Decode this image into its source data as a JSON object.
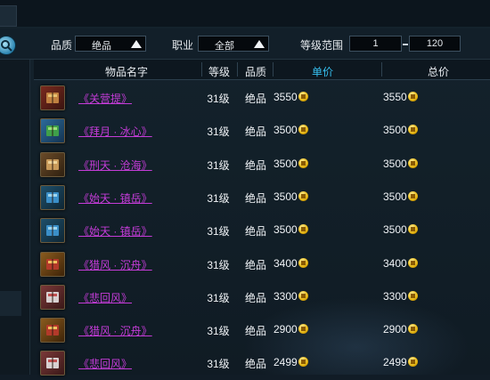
{
  "filters": {
    "quality_label": "品质",
    "quality_value": "绝品",
    "class_label": "职业",
    "class_value": "全部",
    "level_range_label": "等级范围",
    "level_min": "1",
    "level_max": "120"
  },
  "table": {
    "columns": [
      "物品名字",
      "等级",
      "品质",
      "单价",
      "总价"
    ],
    "rows": [
      {
        "name": "《关营提》",
        "level": "31级",
        "quality": "绝品",
        "price": "3550",
        "total": "3550",
        "icon": "gift-box-icon"
      },
      {
        "name": "《拜月 · 冰心》",
        "level": "31级",
        "quality": "绝品",
        "price": "3500",
        "total": "3500",
        "icon": "green-book-icon"
      },
      {
        "name": "《刑天 · 沧海》",
        "level": "31级",
        "quality": "绝品",
        "price": "3500",
        "total": "3500",
        "icon": "scroll-icon"
      },
      {
        "name": "《始天 · 镇岳》",
        "level": "31级",
        "quality": "绝品",
        "price": "3500",
        "total": "3500",
        "icon": "blue-book-icon"
      },
      {
        "name": "《始天 · 镇岳》",
        "level": "31级",
        "quality": "绝品",
        "price": "3500",
        "total": "3500",
        "icon": "blue-book-icon"
      },
      {
        "name": "《猎风 · 沉舟》",
        "level": "31级",
        "quality": "绝品",
        "price": "3400",
        "total": "3400",
        "icon": "red-book-icon"
      },
      {
        "name": "《悲回风》",
        "level": "31级",
        "quality": "绝品",
        "price": "3300",
        "total": "3300",
        "icon": "pink-book-icon"
      },
      {
        "name": "《猎风 · 沉舟》",
        "level": "31级",
        "quality": "绝品",
        "price": "2900",
        "total": "2900",
        "icon": "red-book-icon"
      },
      {
        "name": "《悲回风》",
        "level": "31级",
        "quality": "绝品",
        "price": "2499",
        "total": "2499",
        "icon": "pink-book-icon"
      }
    ]
  },
  "colors": {
    "item_name": "#c43cd8",
    "price_header": "#36c0f0",
    "coin": "#e3b20e"
  }
}
